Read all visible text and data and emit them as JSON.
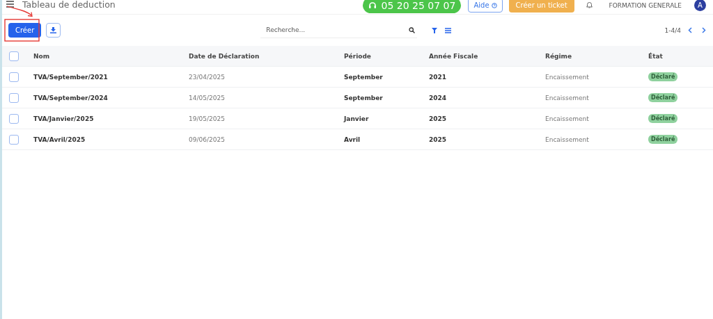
{
  "header": {
    "title": "Tableau de deduction",
    "phone": "05 20 25 07 07",
    "help": "Aide",
    "ticket": "Créer un ticket",
    "company": "FORMATION GENERALE",
    "avatar": "A"
  },
  "toolbar": {
    "create": "Créer",
    "search": {
      "placeholder": "Recherche..."
    },
    "pager": "1-4/4"
  },
  "table": {
    "select_all": {
      "checked": false
    },
    "columns": [
      "Nom",
      "Date de Déclaration",
      "Période",
      "Année Fiscale",
      "Régime",
      "État"
    ],
    "rows": [
      {
        "checked": false,
        "name": "TVA/September/2021",
        "date": "23/04/2025",
        "period": "September",
        "year": "2021",
        "regime": "Encaissement",
        "status": "Déclaré"
      },
      {
        "checked": false,
        "name": "TVA/September/2024",
        "date": "14/05/2025",
        "period": "September",
        "year": "2024",
        "regime": "Encaissement",
        "status": "Déclaré"
      },
      {
        "checked": false,
        "name": "TVA/Janvier/2025",
        "date": "19/05/2025",
        "period": "Janvier",
        "year": "2025",
        "regime": "Encaissement",
        "status": "Déclaré"
      },
      {
        "checked": false,
        "name": "TVA/Avril/2025",
        "date": "09/06/2025",
        "period": "Avril",
        "year": "2025",
        "regime": "Encaissement",
        "status": "Déclaré"
      }
    ]
  }
}
